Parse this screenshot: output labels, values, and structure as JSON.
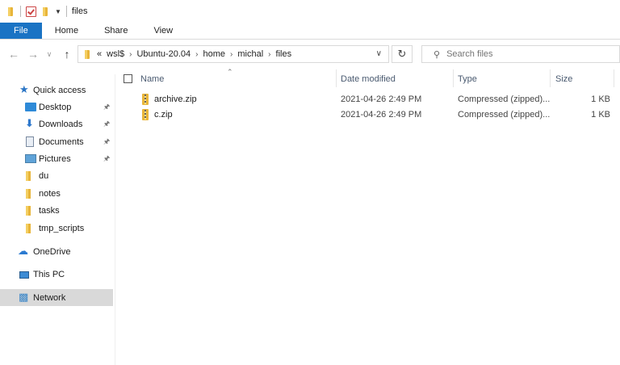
{
  "window": {
    "title": "files"
  },
  "ribbon": {
    "tabs": [
      "File",
      "Home",
      "Share",
      "View"
    ]
  },
  "address": {
    "overflow": "«",
    "crumbs": [
      "wsl$",
      "Ubuntu-20.04",
      "home",
      "michal",
      "files"
    ]
  },
  "search": {
    "placeholder": "Search files"
  },
  "nav": {
    "quick_access": "Quick access",
    "pinned": [
      "Desktop",
      "Downloads",
      "Documents",
      "Pictures"
    ],
    "folders": [
      "du",
      "notes",
      "tasks",
      "tmp_scripts"
    ],
    "onedrive": "OneDrive",
    "thispc": "This PC",
    "network": "Network"
  },
  "columns": {
    "name": "Name",
    "date": "Date modified",
    "type": "Type",
    "size": "Size"
  },
  "files": [
    {
      "name": "archive.zip",
      "date": "2021-04-26 2:49 PM",
      "type": "Compressed (zipped)...",
      "size": "1 KB"
    },
    {
      "name": "c.zip",
      "date": "2021-04-26 2:49 PM",
      "type": "Compressed (zipped)...",
      "size": "1 KB"
    }
  ],
  "icons": {
    "quick_access": "star-icon",
    "desktop": "desktop-icon",
    "downloads": "download-icon",
    "documents": "documents-icon",
    "pictures": "pictures-icon",
    "folder": "folder-icon",
    "onedrive": "cloud-icon",
    "thispc": "computer-icon",
    "network": "network-icon",
    "zip": "zip-folder-icon"
  },
  "colors": {
    "accent": "#1a73c4",
    "selected": "#d9d9d9",
    "folder": "#e8b53a"
  }
}
